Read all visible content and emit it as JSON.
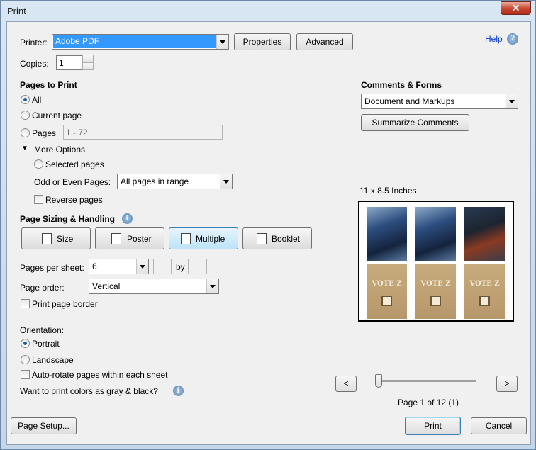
{
  "window": {
    "title": "Print",
    "close": "✕"
  },
  "help": {
    "label": "Help",
    "icon": "?"
  },
  "printer": {
    "label": "Printer:",
    "value": "Adobe PDF",
    "properties": "Properties",
    "advanced": "Advanced"
  },
  "copies": {
    "label": "Copies:",
    "value": "1"
  },
  "pages_to_print": {
    "heading": "Pages to Print",
    "all": "All",
    "current_page": "Current page",
    "pages": "Pages",
    "pages_value": "1 - 72",
    "more_options": "More Options",
    "selected_pages": "Selected pages",
    "odd_even_label": "Odd or Even Pages:",
    "odd_even_value": "All pages in range",
    "reverse_pages": "Reverse pages",
    "selected": "all"
  },
  "sizing": {
    "heading": "Page Sizing & Handling",
    "info": "i",
    "buttons": [
      "Size",
      "Poster",
      "Multiple",
      "Booklet"
    ],
    "selected": "Multiple",
    "pages_per_sheet_label": "Pages per sheet:",
    "pages_per_sheet_value": "6",
    "by_label": "by",
    "page_order_label": "Page order:",
    "page_order_value": "Vertical",
    "print_border": "Print page border"
  },
  "orientation": {
    "heading": "Orientation:",
    "portrait": "Portrait",
    "landscape": "Landscape",
    "auto_rotate": "Auto-rotate pages within each sheet",
    "selected": "portrait"
  },
  "gray": {
    "label": "Want to print colors as gray & black?",
    "info": "i"
  },
  "comments": {
    "heading": "Comments & Forms",
    "value": "Document and Markups",
    "summarize": "Summarize Comments"
  },
  "preview": {
    "size": "11 x 8.5 Inches",
    "logo_text": "VOTE Z",
    "page_status": "Page 1 of 12 (1)",
    "prev": "<",
    "next": ">"
  },
  "footer": {
    "page_setup": "Page Setup...",
    "print": "Print",
    "cancel": "Cancel"
  },
  "colors": {
    "accent": "#1a5fa8",
    "selection": "#3399ff",
    "link": "#0033cc"
  }
}
